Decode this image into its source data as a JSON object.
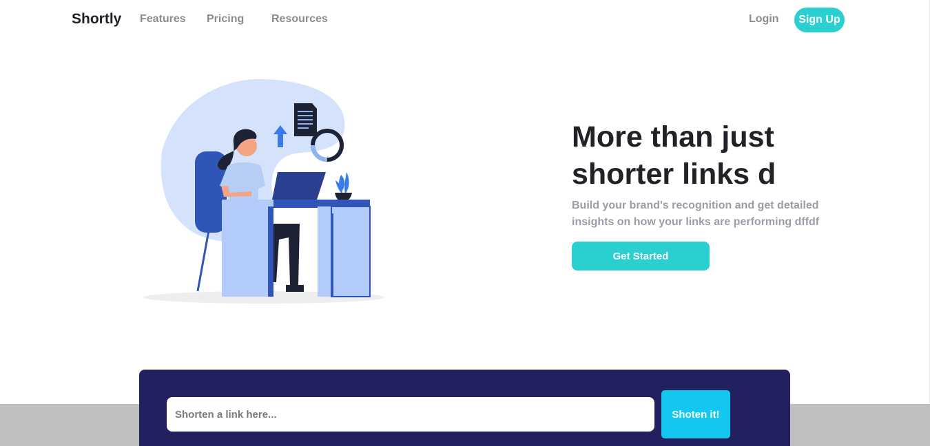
{
  "brand": {
    "name": "Shortly"
  },
  "nav": {
    "links": [
      "Features",
      "Pricing",
      "Resources"
    ],
    "login": "Login",
    "signup": "Sign Up"
  },
  "hero": {
    "title_line1": "More than just",
    "title_line2": "shorter links d",
    "subtitle_line1": "Build your brand's recognition and get detailed",
    "subtitle_line2": "insights on how your links are performing dffdf",
    "cta": "Get Started",
    "illustration": "person-working-at-desk-illustration"
  },
  "shortener": {
    "placeholder": "Shorten a link here...",
    "button": "Shoten it!"
  },
  "colors": {
    "accent": "#2acfcf",
    "dark_violet": "#232060",
    "button_cyan": "#12c8ee",
    "heading": "#232127",
    "muted": "#9e9aa7"
  }
}
